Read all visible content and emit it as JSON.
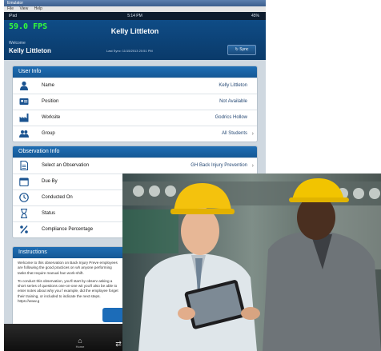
{
  "emulator": {
    "title": "Emulator",
    "menu": [
      "File",
      "View",
      "Help"
    ]
  },
  "status_bar": {
    "carrier": "iPad",
    "time": "5:14 PM",
    "battery": "45%"
  },
  "header": {
    "fps": "59.0 FPS",
    "title": "Kelly Littleton",
    "welcome": "Welcome",
    "user_name": "Kelly Littleton",
    "last_sync": "Last Sync: 11/15/2013 20:51 PM",
    "sync_label": "Sync"
  },
  "user_info": {
    "heading": "User Info",
    "rows": [
      {
        "label": "Name",
        "value": "Kelly Littleton",
        "icon": "person-icon"
      },
      {
        "label": "Position",
        "value": "Not Available",
        "icon": "id-card-icon"
      },
      {
        "label": "Worksite",
        "value": "Godrics Hollow",
        "icon": "factory-icon"
      },
      {
        "label": "Group",
        "value": "All Students",
        "icon": "group-icon"
      }
    ]
  },
  "observation_info": {
    "heading": "Observation Info",
    "rows": [
      {
        "label": "Select an Observation",
        "value": "GH Back Injury Prevention",
        "icon": "document-icon"
      },
      {
        "label": "Due By",
        "value": "",
        "icon": "calendar-icon"
      },
      {
        "label": "Conducted On",
        "value": "",
        "icon": "clock-icon"
      },
      {
        "label": "Status",
        "value": "",
        "icon": "hourglass-icon"
      },
      {
        "label": "Compliance Percentage",
        "value": "",
        "icon": "percent-icon"
      }
    ]
  },
  "instructions": {
    "heading": "Instructions",
    "paragraphs": [
      "Welcome to this observation on Back Injury Preve employees are following the good practices on wh anyone performing tasks that require manual han work-shift.",
      "To conduct this observation, you'll start by observ asking a short series of questions one-on-one wit you'll also be able to enter notes about why you f example, did the employee forget their training, or included to indicate the next steps. https://www.g"
    ]
  },
  "tabbar": {
    "home": "Home"
  },
  "colors": {
    "header_blue": "#0f4c86",
    "section_blue": "#1f6eb4",
    "fps_green": "#32ff3a"
  }
}
